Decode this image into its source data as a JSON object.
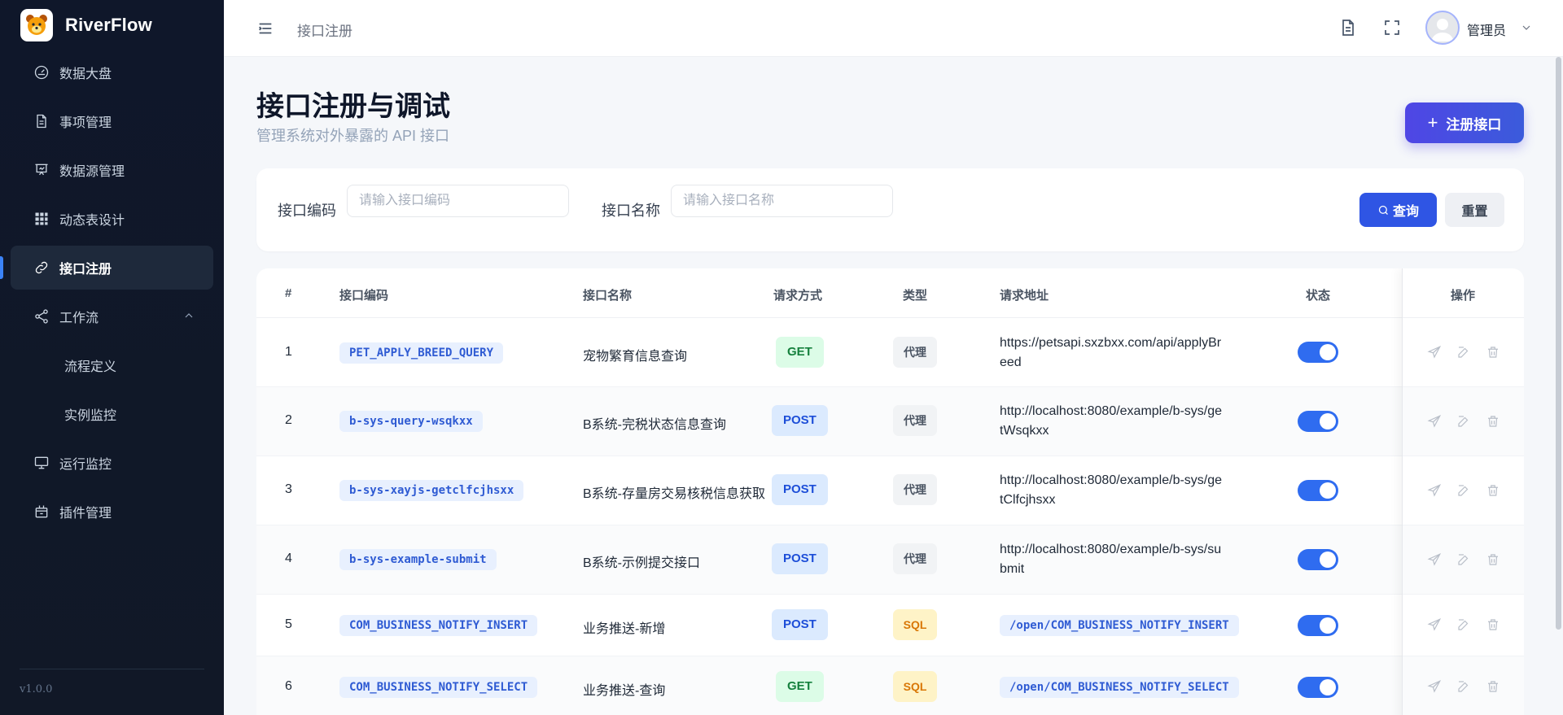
{
  "brand": {
    "name": "RiverFlow",
    "version": "v1.0.0"
  },
  "sidebar": {
    "items": [
      {
        "label": "数据大盘",
        "icon": "gauge-icon"
      },
      {
        "label": "事项管理",
        "icon": "document-icon"
      },
      {
        "label": "数据源管理",
        "icon": "presentation-icon"
      },
      {
        "label": "动态表设计",
        "icon": "grid-icon"
      },
      {
        "label": "接口注册",
        "icon": "link-icon",
        "active": true
      },
      {
        "label": "工作流",
        "icon": "share-icon",
        "expanded": true
      },
      {
        "label": "运行监控",
        "icon": "monitor-icon"
      },
      {
        "label": "插件管理",
        "icon": "package-icon"
      }
    ],
    "workflow_children": [
      "流程定义",
      "实例监控"
    ]
  },
  "header": {
    "breadcrumb": "接口注册",
    "user_name": "管理员"
  },
  "page": {
    "title": "接口注册与调试",
    "subtitle": "管理系统对外暴露的 API 接口",
    "register_button": "注册接口"
  },
  "filters": {
    "code_label": "接口编码",
    "code_placeholder": "请输入接口编码",
    "name_label": "接口名称",
    "name_placeholder": "请输入接口名称",
    "query_button": "查询",
    "reset_button": "重置"
  },
  "table": {
    "columns": [
      "#",
      "接口编码",
      "接口名称",
      "请求方式",
      "类型",
      "请求地址",
      "状态",
      "操作"
    ],
    "rows": [
      {
        "index": "1",
        "code": "PET_APPLY_BREED_QUERY",
        "name": "宠物繁育信息查询",
        "method": "GET",
        "type": "代理",
        "url": "https://petsapi.sxzbxx.com/api/applyBreed",
        "url_lines": [
          "https://petsapi.sxzbxx.com/api/applyBr",
          "eed"
        ],
        "enabled": true
      },
      {
        "index": "2",
        "code": "b-sys-query-wsqkxx",
        "name": "B系统-完税状态信息查询",
        "method": "POST",
        "type": "代理",
        "url": "http://localhost:8080/example/b-sys/getWsqkxx",
        "url_lines": [
          "http://localhost:8080/example/b-sys/ge",
          "tWsqkxx"
        ],
        "enabled": true
      },
      {
        "index": "3",
        "code": "b-sys-xayjs-getclfcjhsxx",
        "name": "B系统-存量房交易核税信息获取",
        "method": "POST",
        "type": "代理",
        "url": "http://localhost:8080/example/b-sys/getClfcjhsxx",
        "url_lines": [
          "http://localhost:8080/example/b-sys/ge",
          "tClfcjhsxx"
        ],
        "enabled": true
      },
      {
        "index": "4",
        "code": "b-sys-example-submit",
        "name": "B系统-示例提交接口",
        "method": "POST",
        "type": "代理",
        "url": "http://localhost:8080/example/b-sys/submit",
        "url_lines": [
          "http://localhost:8080/example/b-sys/su",
          "bmit"
        ],
        "enabled": true
      },
      {
        "index": "5",
        "code": "COM_BUSINESS_NOTIFY_INSERT",
        "name": "业务推送-新增",
        "method": "POST",
        "type": "SQL",
        "url": "/open/COM_BUSINESS_NOTIFY_INSERT",
        "url_lines": [
          "/open/COM_BUSINESS_NOTIFY_INSERT"
        ],
        "enabled": true
      },
      {
        "index": "6",
        "code": "COM_BUSINESS_NOTIFY_SELECT",
        "name": "业务推送-查询",
        "method": "GET",
        "type": "SQL",
        "url": "/open/COM_BUSINESS_NOTIFY_SELECT",
        "url_lines": [
          "/open/COM_BUSINESS_NOTIFY_SELECT"
        ],
        "enabled": true
      }
    ]
  },
  "colors": {
    "accent": "#2f55e4",
    "sidebar_bg": "#0f172a",
    "toggle_on": "#2f6cf0",
    "get": "#15803d",
    "post": "#1d4ed8",
    "sql": "#d97706"
  }
}
